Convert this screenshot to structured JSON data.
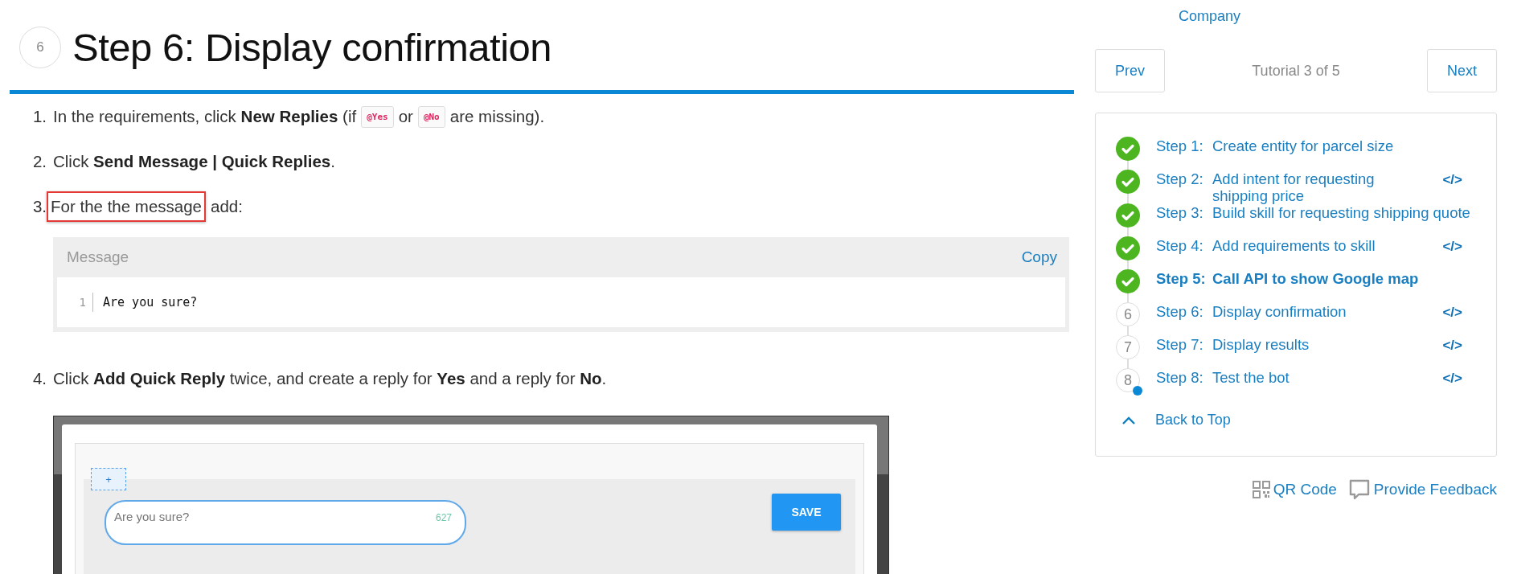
{
  "heading": {
    "number": "6",
    "title": "Step 6: Display confirmation"
  },
  "instructions": [
    {
      "number": "1.",
      "parts": [
        {
          "kind": "text",
          "text": "In the requirements, click **New Replies** (if"
        },
        {
          "kind": "code",
          "text": "@Yes"
        },
        {
          "kind": "text",
          "text": "or"
        },
        {
          "kind": "code",
          "text": "@No"
        },
        {
          "kind": "text",
          "text": "are missing)."
        }
      ]
    },
    {
      "number": "2.",
      "parts": [
        {
          "kind": "text",
          "text": "Click **Send Message | Quick Replies**."
        }
      ]
    },
    {
      "number": "3.",
      "parts": [
        {
          "kind": "boxed",
          "text": "For the the message"
        },
        {
          "kind": "text",
          "text": "add:"
        }
      ]
    }
  ],
  "code_block": {
    "title": "Message",
    "copy": "Copy",
    "lines": [
      {
        "number": "1",
        "text": "Are you sure?"
      }
    ]
  },
  "instruction_4": {
    "number": "4.",
    "text": "Click **Add Quick Reply** twice, and create a reply for **Yes** and a reply for **No**."
  },
  "screenshot": {
    "plus": "+",
    "reply_text": "Are you sure?",
    "counter": "627",
    "save": "SAVE"
  },
  "sidebar": {
    "group_tail": "Company",
    "prev": "Prev",
    "position": "Tutorial 3 of 5",
    "next": "Next",
    "steps": [
      {
        "label": "Step 1:",
        "title": "Create entity for parcel size",
        "done": true,
        "selected": false,
        "dot": false
      },
      {
        "label": "Step 2:",
        "title": "Add intent for requesting shipping price",
        "done": true,
        "selected": false,
        "code": "</>",
        "dot": false
      },
      {
        "label": "Step 3:",
        "title": "Build skill for requesting shipping quote",
        "done": true,
        "selected": false,
        "dot": false
      },
      {
        "label": "Step 4:",
        "title": "Add requirements to skill",
        "done": true,
        "selected": false,
        "code": "</>",
        "dot": false
      },
      {
        "label": "Step 5:",
        "title": "Call API to show Google map",
        "done": true,
        "selected": true,
        "dot": false
      },
      {
        "label": "Step 6:",
        "title": "Display confirmation",
        "number": "6",
        "done": false,
        "selected": false,
        "code": "</>",
        "dot": false
      },
      {
        "label": "Step 7:",
        "title": "Display results",
        "number": "7",
        "done": false,
        "selected": false,
        "code": "</>",
        "dot": false
      },
      {
        "label": "Step 8:",
        "title": "Test the bot",
        "number": "8",
        "done": false,
        "selected": false,
        "code": "</>",
        "dot": true
      }
    ],
    "back_to_top": "Back to Top",
    "qr": "QR Code",
    "feedback": "Provide Feedback"
  }
}
